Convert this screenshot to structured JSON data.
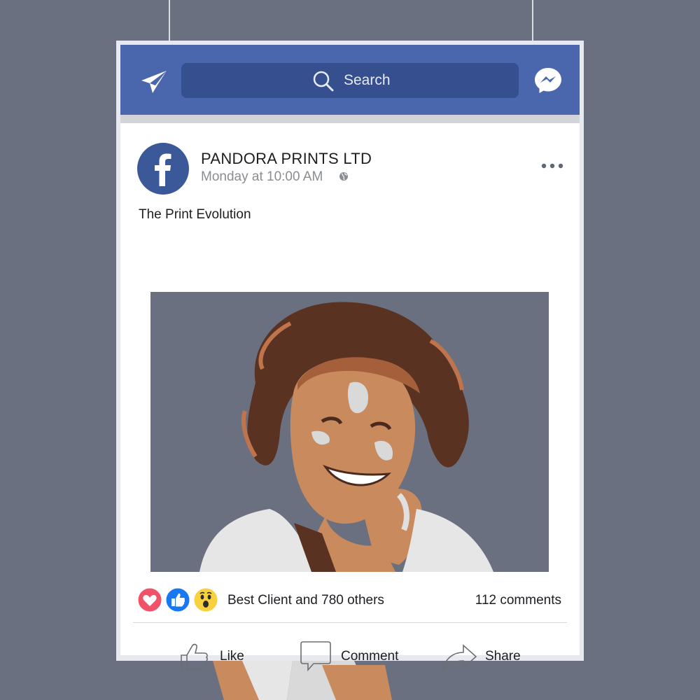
{
  "topbar": {
    "search_placeholder": "Search",
    "left_icon": "send-icon",
    "right_icon": "messenger-icon",
    "color": "#4a66ad"
  },
  "post": {
    "page_name": "PANDORA PRINTS LTD",
    "time": "Monday at 10:00 AM",
    "privacy_icon": "globe-icon",
    "text": "The Print Evolution",
    "reactions": {
      "icons": [
        "heart-reaction-icon",
        "like-reaction-icon",
        "wow-reaction-icon"
      ],
      "summary": "Best Client and 780 others",
      "comments": "112 comments"
    },
    "actions": {
      "like": "Like",
      "comment": "Comment",
      "share": "Share"
    }
  },
  "colors": {
    "background": "#6b7080",
    "facebook_blue": "#3b5998",
    "heart": "#f0526a",
    "like": "#1877f2",
    "wow": "#f7d23e"
  }
}
